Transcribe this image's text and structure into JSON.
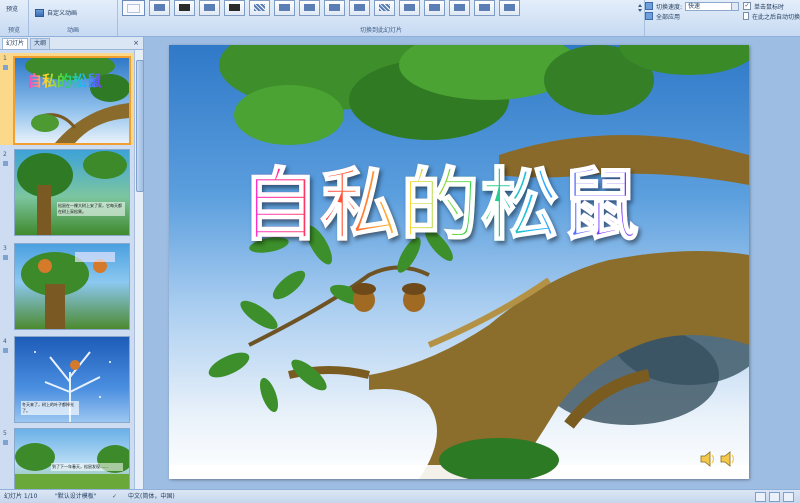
{
  "ribbon": {
    "preview_label": "预览",
    "preview_group_label": "预览",
    "custom_animation_label": "自定义动画",
    "animation_group_label": "动画",
    "transition_group_label": "切换到此幻灯片",
    "transition_speed_label": "切换速度:",
    "transition_speed_value": "快速",
    "apply_all_label": "全部应用",
    "on_click_label": "单击鼠标时",
    "auto_after_label": "在此之后自动切换"
  },
  "pane": {
    "tab_slides": "幻灯片",
    "tab_outline": "大纲",
    "close_glyph": "×",
    "slides": [
      {
        "number": "1",
        "title": "自私的松鼠",
        "caption": "",
        "selected": true
      },
      {
        "number": "2",
        "title": "",
        "caption": "松鼠在一棵大树上安了家，它每天都在树上采松果。",
        "selected": false
      },
      {
        "number": "3",
        "title": "",
        "caption": "",
        "selected": false
      },
      {
        "number": "4",
        "title": "",
        "caption": "冬天来了，树上的叶子都掉光了。",
        "selected": false
      },
      {
        "number": "5",
        "title": "",
        "caption": "到了下一年春天，松鼠发现……",
        "selected": false
      }
    ]
  },
  "slide": {
    "title": "自私的松鼠"
  },
  "status": {
    "slide_info": "幻灯片 1/10",
    "theme": "\"默认设计模板\"",
    "language": "中文(简体，中国)"
  },
  "colors": {
    "ribbon_bg": "#dce8f7",
    "selection": "#f0a030",
    "slide_sky": "#2f79c8"
  }
}
